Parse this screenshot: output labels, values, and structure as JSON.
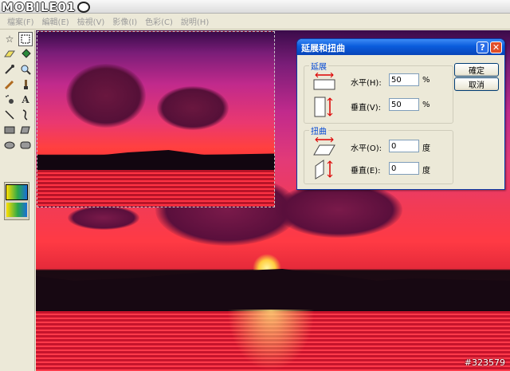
{
  "logo": {
    "text": "MOBILE01"
  },
  "menu": [
    "檔案(F)",
    "編輯(E)",
    "檢視(V)",
    "影像(I)",
    "色彩(C)",
    "說明(H)"
  ],
  "tools": [
    "free-select-icon",
    "rect-select-icon",
    "eraser-icon",
    "fill-icon",
    "picker-icon",
    "magnifier-icon",
    "pencil-icon",
    "brush-icon",
    "airbrush-icon",
    "text-icon",
    "line-icon",
    "curve-icon",
    "rectangle-icon",
    "polygon-icon",
    "ellipse-icon",
    "rounded-rect-icon"
  ],
  "dialog": {
    "title": "延展和扭曲",
    "help": "?",
    "close": "✕",
    "stretch": {
      "legend": "延展",
      "horizontal_label": "水平(H):",
      "horizontal_value": "50",
      "vertical_label": "垂直(V):",
      "vertical_value": "50",
      "unit": "%"
    },
    "skew": {
      "legend": "扭曲",
      "horizontal_label": "水平(O):",
      "horizontal_value": "0",
      "vertical_label": "垂直(E):",
      "vertical_value": "0",
      "unit": "度"
    },
    "ok": "確定",
    "cancel": "取消"
  },
  "watermark": "#323579"
}
